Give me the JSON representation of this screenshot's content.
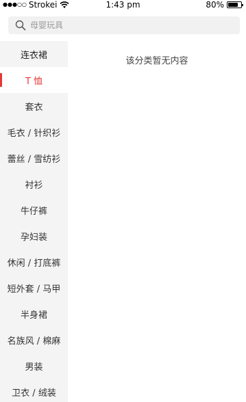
{
  "status_bar": {
    "signal": "●●●○○",
    "carrier": "Strokei",
    "time": "1:43 pm",
    "battery_percent": "80%",
    "battery_level": 0.8
  },
  "search": {
    "placeholder": "母婴玩具",
    "icon": "search-icon"
  },
  "sidebar": {
    "items": [
      {
        "label": "连衣裙"
      },
      {
        "label": "T 恤"
      },
      {
        "label": "套衣"
      },
      {
        "label": "毛衣 / 针织衫"
      },
      {
        "label": "蕾丝 / 雪纺衫"
      },
      {
        "label": "衬衫"
      },
      {
        "label": "牛仔裤"
      },
      {
        "label": "孕妇装"
      },
      {
        "label": "休闲 / 打底裤"
      },
      {
        "label": "短外套 / 马甲"
      },
      {
        "label": "半身裙"
      },
      {
        "label": "名族风 / 棉麻"
      },
      {
        "label": "男装"
      },
      {
        "label": "卫衣 / 绒装"
      }
    ],
    "active_index": 1,
    "accent_color": "#e53935"
  },
  "main": {
    "empty_message": "该分类暂无内容"
  }
}
